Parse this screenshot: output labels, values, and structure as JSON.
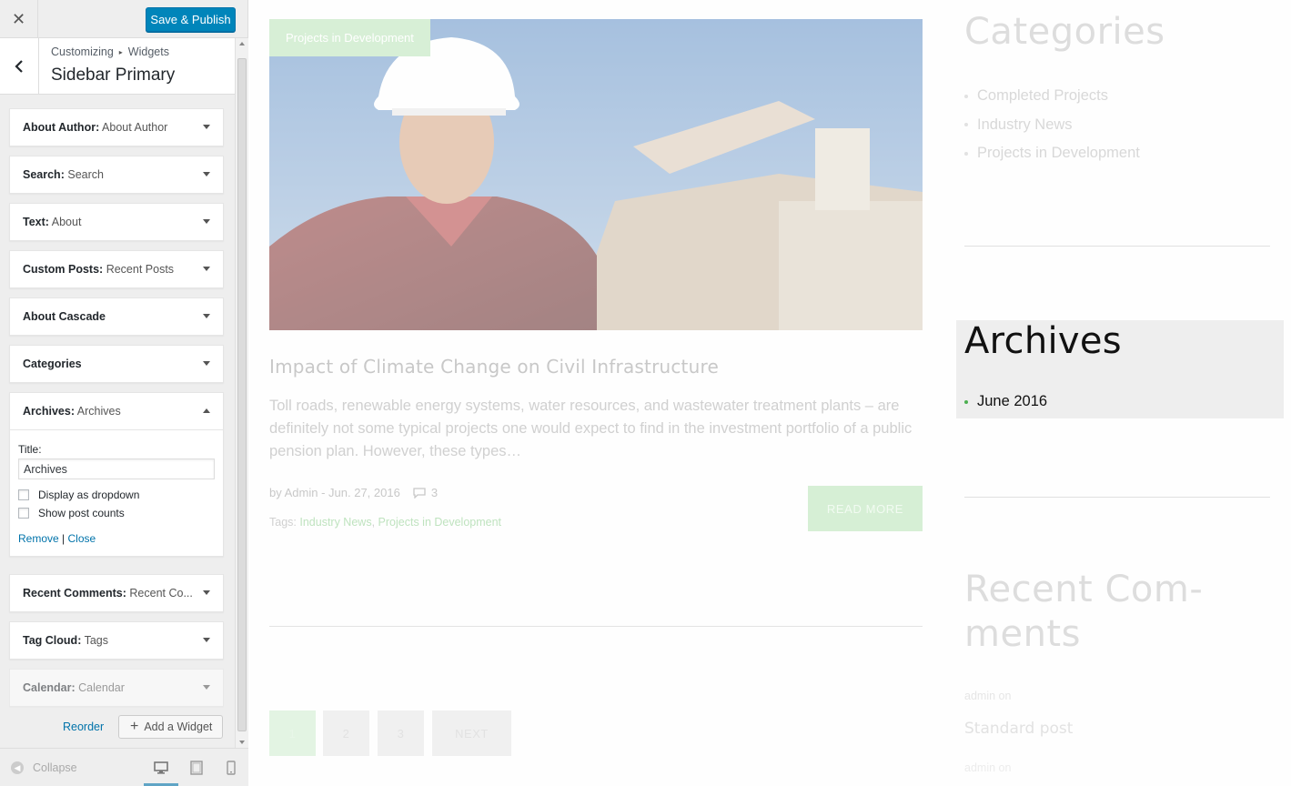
{
  "customizer": {
    "close_icon": "close-icon",
    "save_label": "Save & Publish",
    "breadcrumb": [
      "Customizing",
      "Widgets"
    ],
    "section_title": "Sidebar Primary",
    "widgets": [
      {
        "name": "About Author",
        "sub": "About Author"
      },
      {
        "name": "Search",
        "sub": "Search"
      },
      {
        "name": "Text",
        "sub": "About"
      },
      {
        "name": "Custom Posts",
        "sub": "Recent Posts"
      },
      {
        "name": "About Cascade",
        "sub": ""
      },
      {
        "name": "Categories",
        "sub": ""
      },
      {
        "name": "Archives",
        "sub": "Archives"
      },
      {
        "name": "Recent Comments",
        "sub": "Recent Co..."
      },
      {
        "name": "Tag Cloud",
        "sub": "Tags"
      },
      {
        "name": "Calendar",
        "sub": "Calendar"
      }
    ],
    "archives_form": {
      "title_label": "Title:",
      "title_value": "Archives",
      "dropdown_label": "Display as dropdown",
      "counts_label": "Show post counts",
      "remove_label": "Remove",
      "separator": "|",
      "close_label": "Close"
    },
    "reorder_label": "Reorder",
    "add_widget_label": "Add a Widget",
    "collapse_label": "Collapse"
  },
  "preview": {
    "post": {
      "category_tag": "Projects in Development",
      "title": "Impact of Climate Change on Civil Infrastructure",
      "excerpt": "Toll roads, renewable energy systems, water resources, and wastewater treatment plants – are definitely not some typical projects one would expect to find in the investment portfolio of a public pension plan. However, these types…",
      "meta": "by Admin - Jun. 27, 2016",
      "comment_count": "3",
      "tags_label": "Tags:",
      "tags": [
        "Industry News",
        "Projects in Development"
      ],
      "tags_separator": ",",
      "read_more": "READ MORE"
    },
    "pagination": [
      "1",
      "2",
      "3",
      "NEXT"
    ],
    "sidebar": {
      "categories_title": "Categories",
      "categories": [
        "Completed Projects",
        "Industry News",
        "Projects in Development"
      ],
      "archives_title": "Archives",
      "archives": [
        "June 2016"
      ],
      "recent_comments_title": "Recent Com-ments",
      "recent_comment_author": "admin on",
      "recent_comment_post": "Standard post",
      "recent_comment_author_2": "admin on"
    }
  },
  "colors": {
    "accent": "#0085ba",
    "link": "#0073aa",
    "green": "#4caf50"
  }
}
